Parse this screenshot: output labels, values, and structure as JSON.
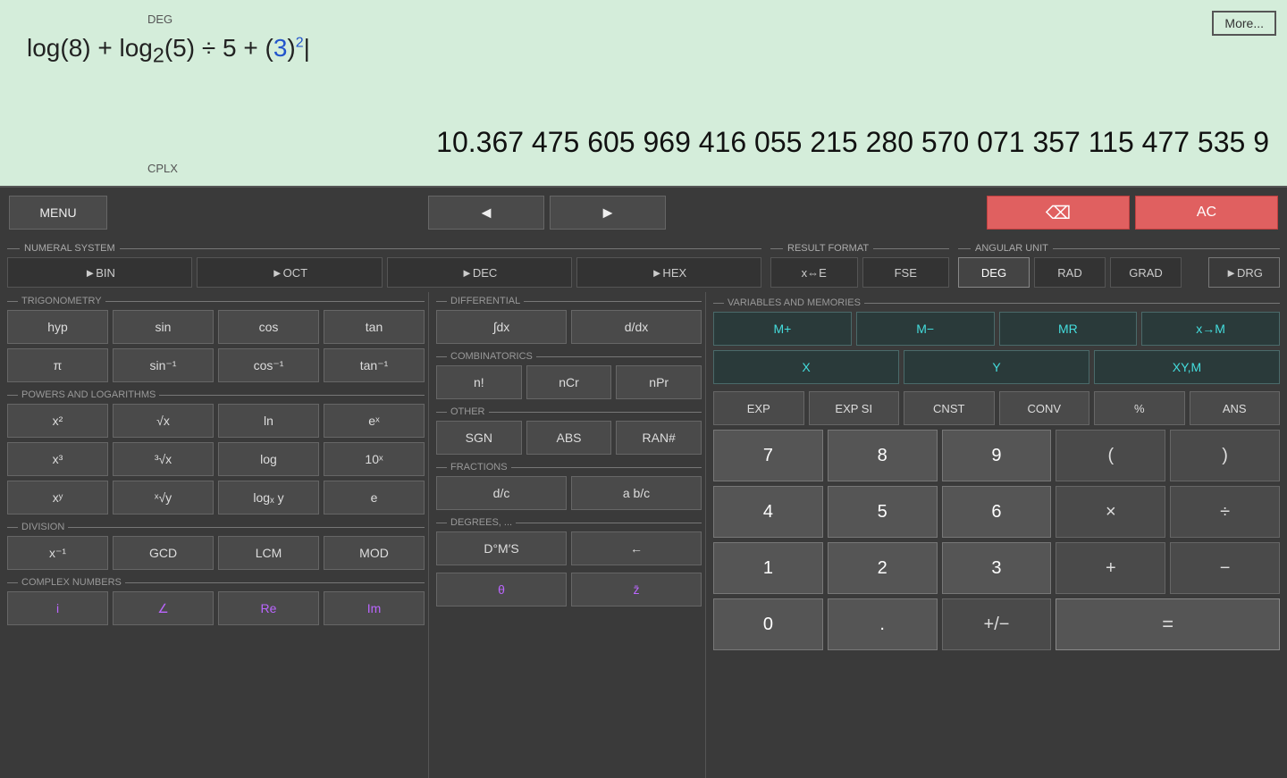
{
  "display": {
    "deg_label": "DEG",
    "cplx_label": "CPLX",
    "more_btn": "More...",
    "expression_html": "log(8) + log<sub>2</sub>(5) ÷ 5 + (<span class='blue'>3</span>)<sup><span class='blue'>2</span></sup>",
    "result": "10.367 475 605 969 416 055 215 280 570 071 357 115 477 535 9"
  },
  "toolbar": {
    "menu": "MENU",
    "left_arrow": "◄",
    "right_arrow": "►",
    "backspace": "⌫",
    "ac": "AC"
  },
  "numeral_system": {
    "header": "NUMERAL SYSTEM",
    "btn_bin": "►BIN",
    "btn_oct": "►OCT",
    "btn_dec": "►DEC",
    "btn_hex": "►HEX"
  },
  "result_format": {
    "header": "RESULT FORMAT",
    "btn_xe": "x⇔E",
    "btn_fse": "FSE"
  },
  "angular_unit": {
    "header": "ANGULAR UNIT",
    "btn_deg": "DEG",
    "btn_rad": "RAD",
    "btn_grad": "GRAD",
    "btn_drg": "►DRG"
  },
  "trigonometry": {
    "header": "TRIGONOMETRY",
    "btn_hyp": "hyp",
    "btn_sin": "sin",
    "btn_cos": "cos",
    "btn_tan": "tan",
    "btn_pi": "π",
    "btn_sin_inv": "sin⁻¹",
    "btn_cos_inv": "cos⁻¹",
    "btn_tan_inv": "tan⁻¹"
  },
  "powers": {
    "header": "POWERS AND LOGARITHMS",
    "btn_x2": "x²",
    "btn_sqrt": "√x",
    "btn_ln": "ln",
    "btn_ex": "eˣ",
    "btn_x3": "x³",
    "btn_cbrt": "³√x",
    "btn_log": "log",
    "btn_10x": "10ˣ",
    "btn_xy": "xʸ",
    "btn_xrty": "ˣ√y",
    "btn_logxy": "logₓ y",
    "btn_e": "e"
  },
  "division": {
    "header": "DIVISION",
    "btn_xinv": "x⁻¹",
    "btn_gcd": "GCD",
    "btn_lcm": "LCM",
    "btn_mod": "MOD"
  },
  "complex": {
    "header": "COMPLEX NUMBERS",
    "btn_i": "i",
    "btn_angle": "∠",
    "btn_re": "Re",
    "btn_im": "Im",
    "btn_theta": "θ",
    "btn_zbar": "z̄"
  },
  "differential": {
    "header": "DIFFERENTIAL",
    "btn_int": "∫dx",
    "btn_diff": "d/dx"
  },
  "combinatorics": {
    "header": "COMBINATORICS",
    "btn_nfact": "n!",
    "btn_ncr": "nCr",
    "btn_npr": "nPr"
  },
  "other": {
    "header": "OTHER",
    "btn_sgn": "SGN",
    "btn_abs": "ABS",
    "btn_ran": "RAN#"
  },
  "fractions": {
    "header": "FRACTIONS",
    "btn_dc": "d/c",
    "btn_abdc": "a b/c"
  },
  "degrees": {
    "header": "DEGREES, ...",
    "btn_dms": "D°M′S",
    "btn_back": "←"
  },
  "variables": {
    "header": "VARIABLES AND MEMORIES",
    "btn_mplus": "M+",
    "btn_mminus": "M−",
    "btn_mr": "MR",
    "btn_xm": "x→M",
    "btn_x": "X",
    "btn_y": "Y",
    "btn_xym": "XY,M"
  },
  "numpad": {
    "btn_exp": "EXP",
    "btn_expsi": "EXP SI",
    "btn_cnst": "CNST",
    "btn_conv": "CONV",
    "btn_pct": "%",
    "btn_ans": "ANS",
    "btn_7": "7",
    "btn_8": "8",
    "btn_9": "9",
    "btn_lparen": "(",
    "btn_rparen": ")",
    "btn_4": "4",
    "btn_5": "5",
    "btn_6": "6",
    "btn_mul": "×",
    "btn_div": "÷",
    "btn_1": "1",
    "btn_2": "2",
    "btn_3": "3",
    "btn_plus": "+",
    "btn_minus": "−",
    "btn_0": "0",
    "btn_dot": ".",
    "btn_pm": "+/−",
    "btn_eq": "="
  }
}
